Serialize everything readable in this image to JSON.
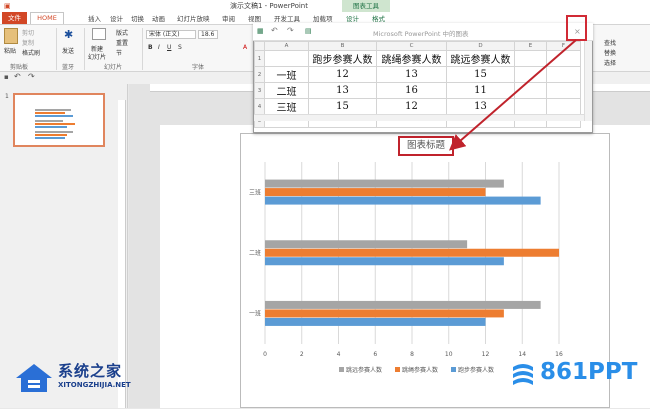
{
  "window": {
    "title": "演示文稿1 - PowerPoint",
    "context_group": "图表工具"
  },
  "tabs": {
    "file": "文件",
    "home": "HOME",
    "items": [
      "插入",
      "设计",
      "切换",
      "动画",
      "幻灯片放映",
      "审阅",
      "视图",
      "开发工具",
      "加载项",
      "设计",
      "格式"
    ]
  },
  "ribbon": {
    "paste": "粘贴",
    "cut": "剪切",
    "copy": "复制",
    "format_painter": "格式刷",
    "clipboard_group": "剪贴板",
    "bluetooth": "发送",
    "bluetooth_group": "蓝牙",
    "new_slide": "新建",
    "new_slide2": "幻灯片",
    "layout": "版式",
    "reset": "重置",
    "section": "节",
    "slides_group": "幻灯片",
    "font_name": "宋体 (正文)",
    "font_size": "18.6",
    "font_group": "字体",
    "find": "查找",
    "replace": "替换",
    "select": "选择"
  },
  "thumbnail": {
    "number": "1"
  },
  "sheet": {
    "title": "Microsoft PowerPoint 中的图表",
    "close": "×",
    "col_headers": [
      "",
      "A",
      "B",
      "C",
      "D",
      "E",
      "F"
    ],
    "rows": [
      {
        "n": "1",
        "cells": [
          "",
          "跑步参赛人数",
          "跳绳参赛人数",
          "跳远参赛人数",
          "",
          ""
        ]
      },
      {
        "n": "2",
        "cells": [
          "一班",
          "12",
          "13",
          "15",
          "",
          ""
        ]
      },
      {
        "n": "3",
        "cells": [
          "二班",
          "13",
          "16",
          "11",
          "",
          ""
        ]
      },
      {
        "n": "4",
        "cells": [
          "三班",
          "15",
          "12",
          "13",
          "",
          ""
        ]
      },
      {
        "n": "5",
        "cells": [
          "",
          "",
          "",
          "",
          "",
          ""
        ]
      }
    ]
  },
  "chart_data": {
    "type": "bar",
    "orientation": "horizontal",
    "title": "图表标题",
    "categories": [
      "一班",
      "二班",
      "三班"
    ],
    "series": [
      {
        "name": "跑步参赛人数",
        "values": [
          12,
          13,
          15
        ],
        "color": "#5b9bd5"
      },
      {
        "name": "跳绳参赛人数",
        "values": [
          13,
          16,
          12
        ],
        "color": "#ed7d31"
      },
      {
        "name": "跳远参赛人数",
        "values": [
          15,
          11,
          13
        ],
        "color": "#a5a5a5"
      }
    ],
    "xlim": [
      0,
      16
    ],
    "xticks": [
      "0",
      "2",
      "4",
      "6",
      "8",
      "10",
      "12",
      "14",
      "16"
    ],
    "grid": true,
    "legend": "bottom"
  },
  "watermarks": {
    "left_cn": "系统之家",
    "left_en": "XITONGZHIJIA.NET",
    "right": "861PPT"
  }
}
